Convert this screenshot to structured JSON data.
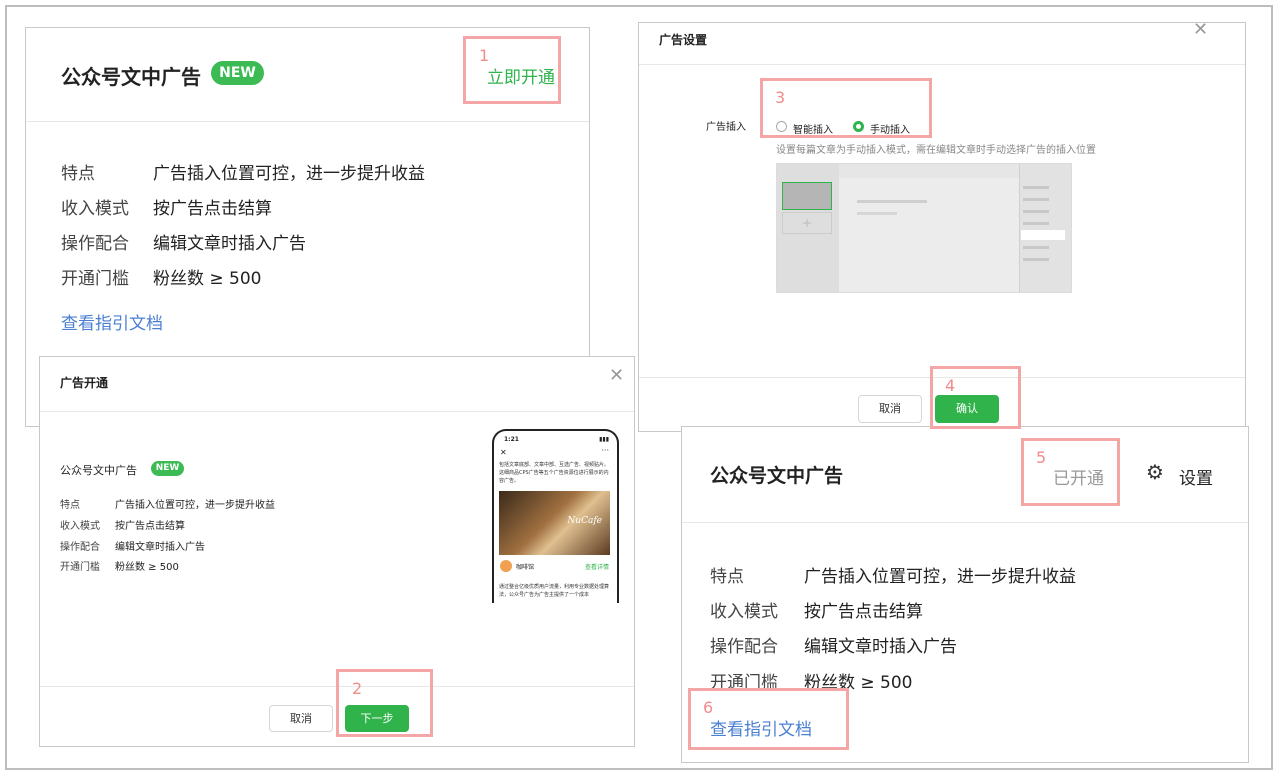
{
  "card1": {
    "title": "公众号文中广告",
    "badge": "NEW",
    "action": "立即开通",
    "rows": [
      {
        "label": "特点",
        "value": "广告插入位置可控，进一步提升收益"
      },
      {
        "label": "收入模式",
        "value": "按广告点击结算"
      },
      {
        "label": "操作配合",
        "value": "编辑文章时插入广告"
      },
      {
        "label": "开通门槛",
        "value": "粉丝数 ≥ 500"
      }
    ],
    "guide_link": "查看指引文档"
  },
  "dialog_open": {
    "title": "广告开通",
    "ad_title": "公众号文中广告",
    "badge": "NEW",
    "rows": [
      {
        "label": "特点",
        "value": "广告插入位置可控，进一步提升收益"
      },
      {
        "label": "收入模式",
        "value": "按广告点击结算"
      },
      {
        "label": "操作配合",
        "value": "编辑文章时插入广告"
      },
      {
        "label": "开通门槛",
        "value": "粉丝数 ≥ 500"
      }
    ],
    "cancel": "取消",
    "next": "下一步",
    "phone": {
      "time": "1:21",
      "intro": "包括文章底部、文章中部、互选广告、视频贴片。这细商品CPS广告等五个广告资源位进行展示的内容广告。",
      "image_text": "NuCafe",
      "brand": "咖啡馆",
      "cta": "查看详情",
      "footer": "通过整合亿级优质用户流量，利用专业数据处理算法，公众号广告为广告主提供了一个成本"
    }
  },
  "dialog_settings": {
    "title": "广告设置",
    "insert_label": "广告插入",
    "option_smart": "智能插入",
    "option_manual": "手动插入",
    "selected": "手动插入",
    "hint": "设置每篇文章为手动插入模式，需在编辑文章时手动选择广告的插入位置",
    "cancel": "取消",
    "confirm": "确认"
  },
  "card2": {
    "title": "公众号文中广告",
    "status": "已开通",
    "settings": "设置",
    "rows": [
      {
        "label": "特点",
        "value": "广告插入位置可控，进一步提升收益"
      },
      {
        "label": "收入模式",
        "value": "按广告点击结算"
      },
      {
        "label": "操作配合",
        "value": "编辑文章时插入广告"
      },
      {
        "label": "开通门槛",
        "value": "粉丝数 ≥ 500"
      }
    ],
    "guide_link": "查看指引文档"
  },
  "steps": [
    "1",
    "2",
    "3",
    "4",
    "5",
    "6"
  ],
  "colors": {
    "accent_green": "#2fb34a",
    "link_blue": "#4a7fd1",
    "highlight": "#f4a6a6",
    "step_number": "#f08c8c"
  }
}
